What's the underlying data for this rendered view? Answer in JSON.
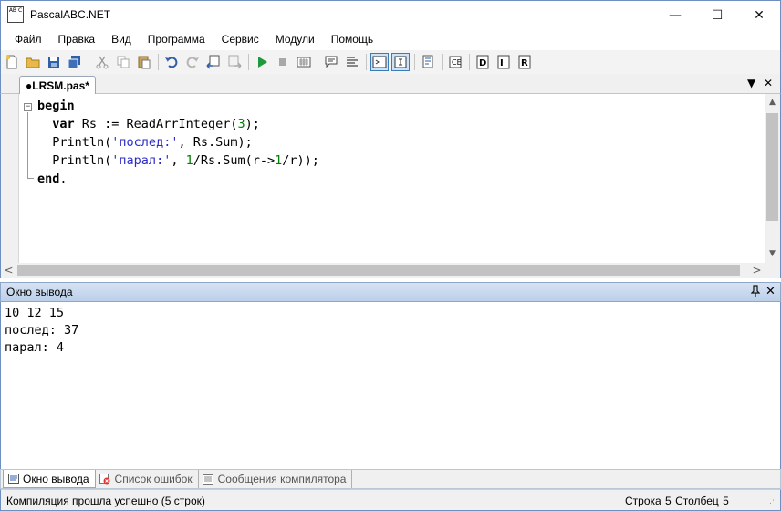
{
  "window": {
    "title": "PascalABC.NET",
    "icon_label": "AB C",
    "minimize_glyph": "—",
    "maximize_glyph": "☐",
    "close_glyph": "✕"
  },
  "menu": [
    "Файл",
    "Правка",
    "Вид",
    "Программа",
    "Сервис",
    "Модули",
    "Помощь"
  ],
  "toolbar": {
    "buttons": [
      "new-file-icon",
      "open-folder-icon",
      "save-icon",
      "save-all-icon",
      "cut-icon",
      "copy-icon",
      "paste-icon",
      "undo-icon",
      "redo-icon",
      "navigate-back-icon",
      "navigate-forward-icon",
      "run-icon",
      "stop-icon",
      "compile-icon",
      "comment-icon",
      "uncomment-icon",
      "output-window-toggle-icon",
      "form-view-toggle-icon",
      "debug-icon",
      "breakpoint-icon",
      "debug-step-into-icon",
      "debug-step-over-icon",
      "debug-run-to-icon"
    ]
  },
  "editor": {
    "tab_label": "●LRSM.pas*",
    "tab_menu_glyph": "▼",
    "tab_close_glyph": "✕",
    "fold_glyph": "−",
    "code": {
      "l1_kw": "begin",
      "l2_kw": "var",
      "l2_a": " Rs := ReadArrInteger(",
      "l2_num": "3",
      "l2_b": ");",
      "l3_a": "Println(",
      "l3_str": "'послед:'",
      "l3_b": ", Rs.Sum);",
      "l4_a": "Println(",
      "l4_str": "'парал:'",
      "l4_b": ", ",
      "l4_num1": "1",
      "l4_c": "/Rs.Sum(r->",
      "l4_num2": "1",
      "l4_d": "/r));",
      "l5_kw": "end",
      "l5_tail": "."
    },
    "scroll_up": "▲",
    "scroll_down": "▼",
    "scroll_left": "<",
    "scroll_right": ">"
  },
  "output": {
    "header": "Окно вывода",
    "pin_glyph": "ꟷ",
    "close_glyph": "✕",
    "lines": [
      "10 12 15",
      "послед: 37",
      "парал: 4"
    ]
  },
  "bottom_tabs": [
    {
      "label": "Окно вывода",
      "active": true
    },
    {
      "label": "Список ошибок",
      "active": false
    },
    {
      "label": "Сообщения компилятора",
      "active": false
    }
  ],
  "status": {
    "message": "Компиляция прошла успешно (5 строк)",
    "row_label": "Строка",
    "row_value": "5",
    "col_label": "Столбец",
    "col_value": "5"
  },
  "colors": {
    "string": "#2b2bc8",
    "number": "#008000",
    "panel_header": "#bcd0ea",
    "frame": "#6c8fbf"
  }
}
